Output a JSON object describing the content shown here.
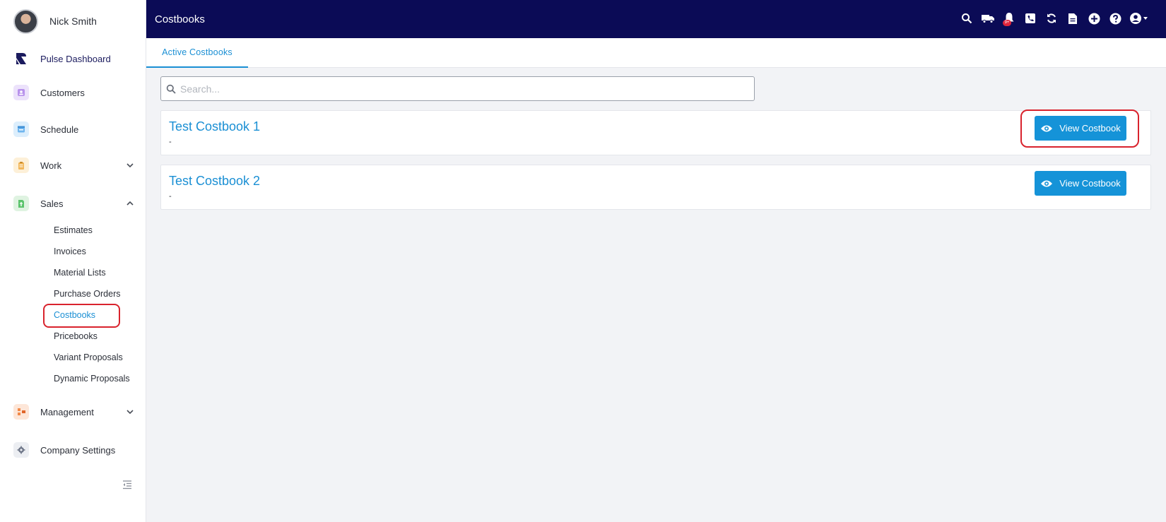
{
  "user": {
    "name": "Nick Smith"
  },
  "sidebar": {
    "items": [
      {
        "label": "Pulse Dashboard",
        "icon": "pulse-logo-icon",
        "color": "#1b1b5e"
      },
      {
        "label": "Customers",
        "icon": "customer-icon",
        "color": "#b892ec"
      },
      {
        "label": "Schedule",
        "icon": "calendar-icon",
        "color": "#6fb6ef"
      },
      {
        "label": "Work",
        "icon": "clipboard-icon",
        "color": "#f2b75a"
      },
      {
        "label": "Sales",
        "icon": "sales-icon",
        "color": "#5cc46d"
      },
      {
        "label": "Management",
        "icon": "management-icon",
        "color": "#f28a4a"
      },
      {
        "label": "Company Settings",
        "icon": "gear-icon",
        "color": "#8a92a3"
      }
    ],
    "sales_sub": [
      {
        "label": "Estimates"
      },
      {
        "label": "Invoices"
      },
      {
        "label": "Material Lists"
      },
      {
        "label": "Purchase Orders"
      },
      {
        "label": "Costbooks",
        "active": true
      },
      {
        "label": "Pricebooks"
      },
      {
        "label": "Variant Proposals"
      },
      {
        "label": "Dynamic Proposals"
      }
    ]
  },
  "header": {
    "title": "Costbooks",
    "notification_badge": "9+",
    "icons": [
      "search-icon",
      "truck-icon",
      "bell-icon",
      "phone-icon",
      "refresh-icon",
      "document-icon",
      "plus-circle-icon",
      "help-icon",
      "account-icon"
    ]
  },
  "tabs": [
    {
      "label": "Active Costbooks"
    }
  ],
  "search": {
    "placeholder": "Search..."
  },
  "costbooks": [
    {
      "title": "Test Costbook 1",
      "subtitle": "-",
      "button": "View Costbook"
    },
    {
      "title": "Test Costbook 2",
      "subtitle": "-",
      "button": "View Costbook"
    }
  ],
  "colors": {
    "accent": "#1593d8",
    "topbar": "#0b0b56",
    "highlight": "#d9232d"
  }
}
